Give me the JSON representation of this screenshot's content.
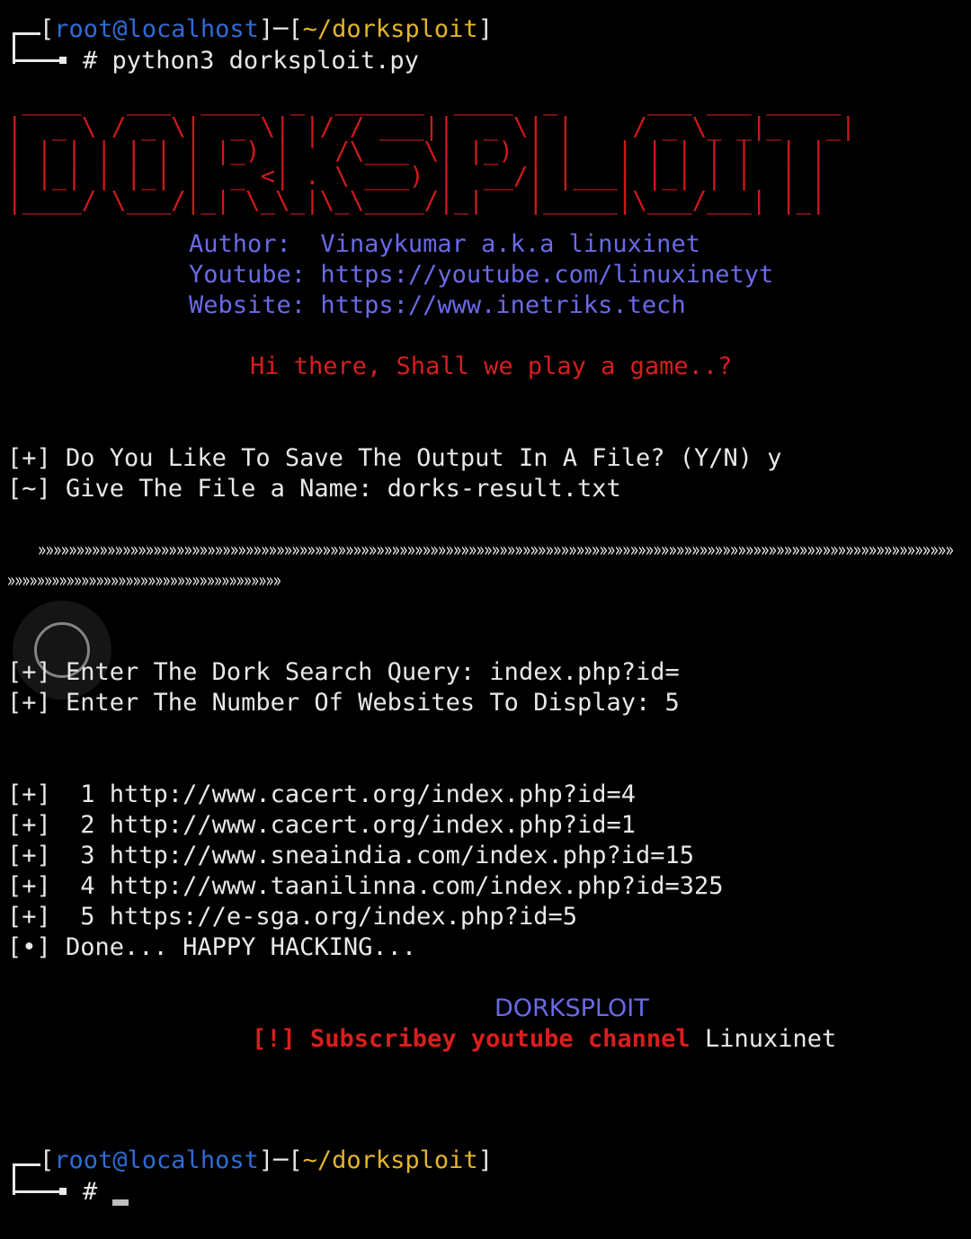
{
  "prompt": {
    "open_bracket": "[",
    "user": "root@localhost",
    "separator": "]─[",
    "path": "~/dorksploit",
    "close_bracket": "]",
    "hash": "#"
  },
  "command": "python3 dorksploit.py",
  "banner": {
    "text": " ____   ___  ____  _  ______  ____  _      ___ ___ _____ \n|  _ \\ / _ \\|  _ \\| |/ / ___||  _ \\| |    / _ \\_ _|_   _|\n| | | | | | | |_) | ' /\\___ \\| |_) | |   | | | | |  | |  \n| |_| | |_| |  _ <| . \\ ___) |  __/| |___| |_| | |  | |  \n|____/ \\___/|_| \\_\\_|\\_\\____/|_|   |_____|\\___/___| |_|  "
  },
  "info": {
    "author_label": "Author:",
    "author_value": "Vinaykumar a.k.a linuxinet",
    "youtube_label": "Youtube:",
    "youtube_value": "https://youtube.com/linuxinetyt",
    "website_label": "Website:",
    "website_value": "https://www.inetriks.tech"
  },
  "tagline": "Hi there, Shall we play a game..?",
  "save_question": "[+] Do You Like To Save The Output In A File? (Y/N) y",
  "file_name_line": "[~] Give The File a Name: dorks-result.txt",
  "separator_line_1": "»»»»»»»»»»»»»»»»»»»»»»»»»»»»»»»»»»»»»»»»»»»»»»»»»»»»»»»»»»»»»»»»»»»»»»»»»»»»»»»»»»»»»»»»»»»»»»»»»»»»»»»»»»»»»»»»»»»»»»»",
  "separator_line_2": "»»»»»»»»»»»»»»»»»»»»»»»»»»»»»»»»»»»»»",
  "query_line": "[+] Enter The Dork Search Query: index.php?id=",
  "count_line": "[+] Enter The Number Of Websites To Display: 5",
  "results": [
    "[+]  1 http://www.cacert.org/index.php?id=4",
    "[+]  2 http://www.cacert.org/index.php?id=1",
    "[+]  3 http://www.sneaindia.com/index.php?id=15",
    "[+]  4 http://www.taanilinna.com/index.php?id=325",
    "[+]  5 https://e-sga.org/index.php?id=5"
  ],
  "done_line": "[•] Done... HAPPY HACKING...",
  "footer": {
    "title": "DORKSPLOIT",
    "subscribe_prefix": "[!] Subscribey youtube channel",
    "subscribe_name": "Linuxinet"
  },
  "colors": {
    "background": "#000000",
    "user": "#2f6cd6",
    "path": "#e3b52b",
    "red": "#d81e1e",
    "blue": "#6a6ae8"
  }
}
